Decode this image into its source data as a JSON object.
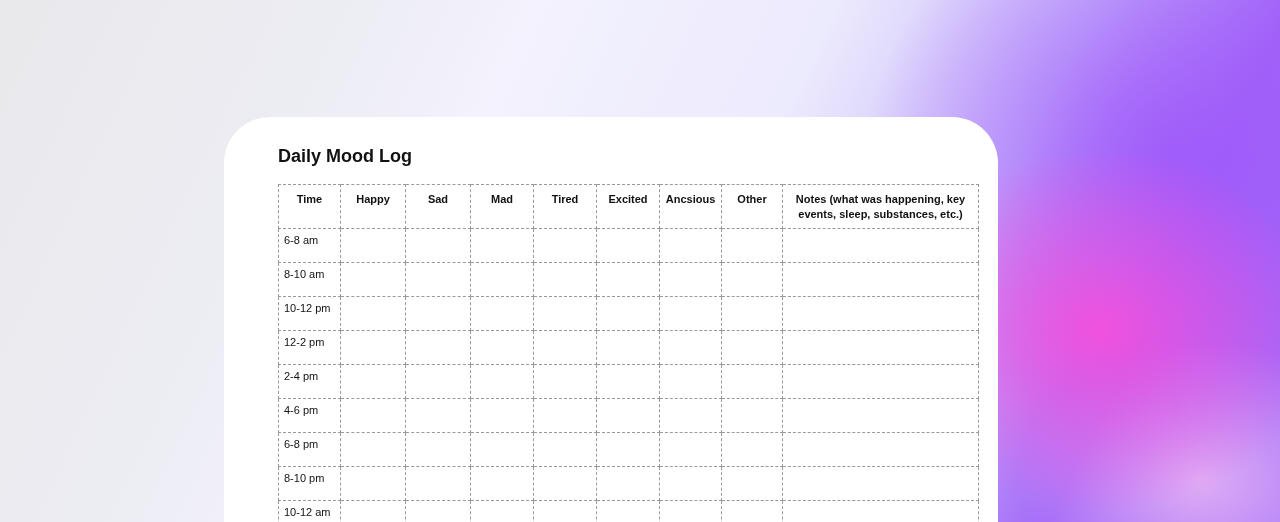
{
  "document": {
    "title": "Daily Mood Log"
  },
  "table": {
    "columns": [
      "Time",
      "Happy",
      "Sad",
      "Mad",
      "Tired",
      "Excited",
      "Ancsious",
      "Other",
      "Notes (what was happening, key events, sleep, substances, etc.)"
    ],
    "rows": [
      {
        "time": "6-8 am"
      },
      {
        "time": "8-10 am"
      },
      {
        "time": "10-12 pm"
      },
      {
        "time": "12-2 pm"
      },
      {
        "time": "2-4 pm"
      },
      {
        "time": "4-6 pm"
      },
      {
        "time": "6-8 pm"
      },
      {
        "time": "8-10 pm"
      },
      {
        "time": "10-12 am"
      }
    ]
  }
}
